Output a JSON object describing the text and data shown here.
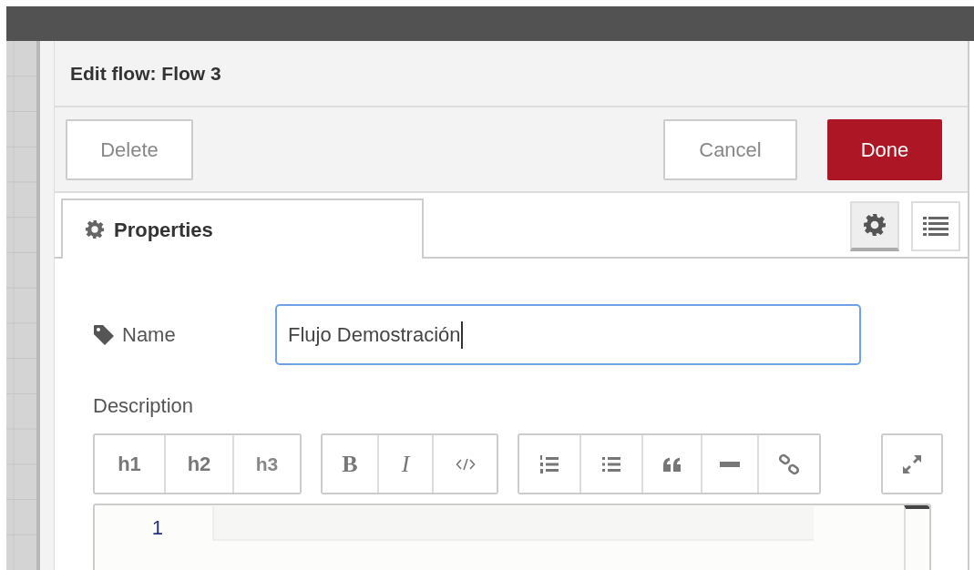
{
  "header": {
    "title": "Edit flow: Flow 3"
  },
  "buttons": [
    {
      "label": "Delete",
      "kind": "plain"
    },
    {
      "label": "Cancel",
      "kind": "plain"
    },
    {
      "label": "Done",
      "kind": "primary"
    }
  ],
  "tabs": [
    {
      "label": "Properties",
      "selected": true
    }
  ],
  "side_tabs": [
    {
      "kind": "settings",
      "selected": true
    },
    {
      "kind": "list",
      "selected": false
    }
  ],
  "form": {
    "name_label": "Name",
    "name_value": "Flujo Demostración",
    "description_label": "Description"
  },
  "toolbar": [
    [
      {
        "kind": "heading",
        "label": "h1"
      },
      {
        "kind": "heading",
        "label": "h2"
      },
      {
        "kind": "heading-light",
        "label": "h3"
      }
    ],
    [
      {
        "kind": "bold",
        "label": "B"
      },
      {
        "kind": "italic",
        "label": "I"
      },
      {
        "kind": "code"
      }
    ],
    [
      {
        "kind": "ordered-list"
      },
      {
        "kind": "bullet-list"
      },
      {
        "kind": "quote"
      },
      {
        "kind": "rule"
      },
      {
        "kind": "link"
      }
    ],
    [
      {
        "kind": "expand"
      }
    ]
  ],
  "editor": {
    "line_numbers": [
      "1"
    ]
  }
}
